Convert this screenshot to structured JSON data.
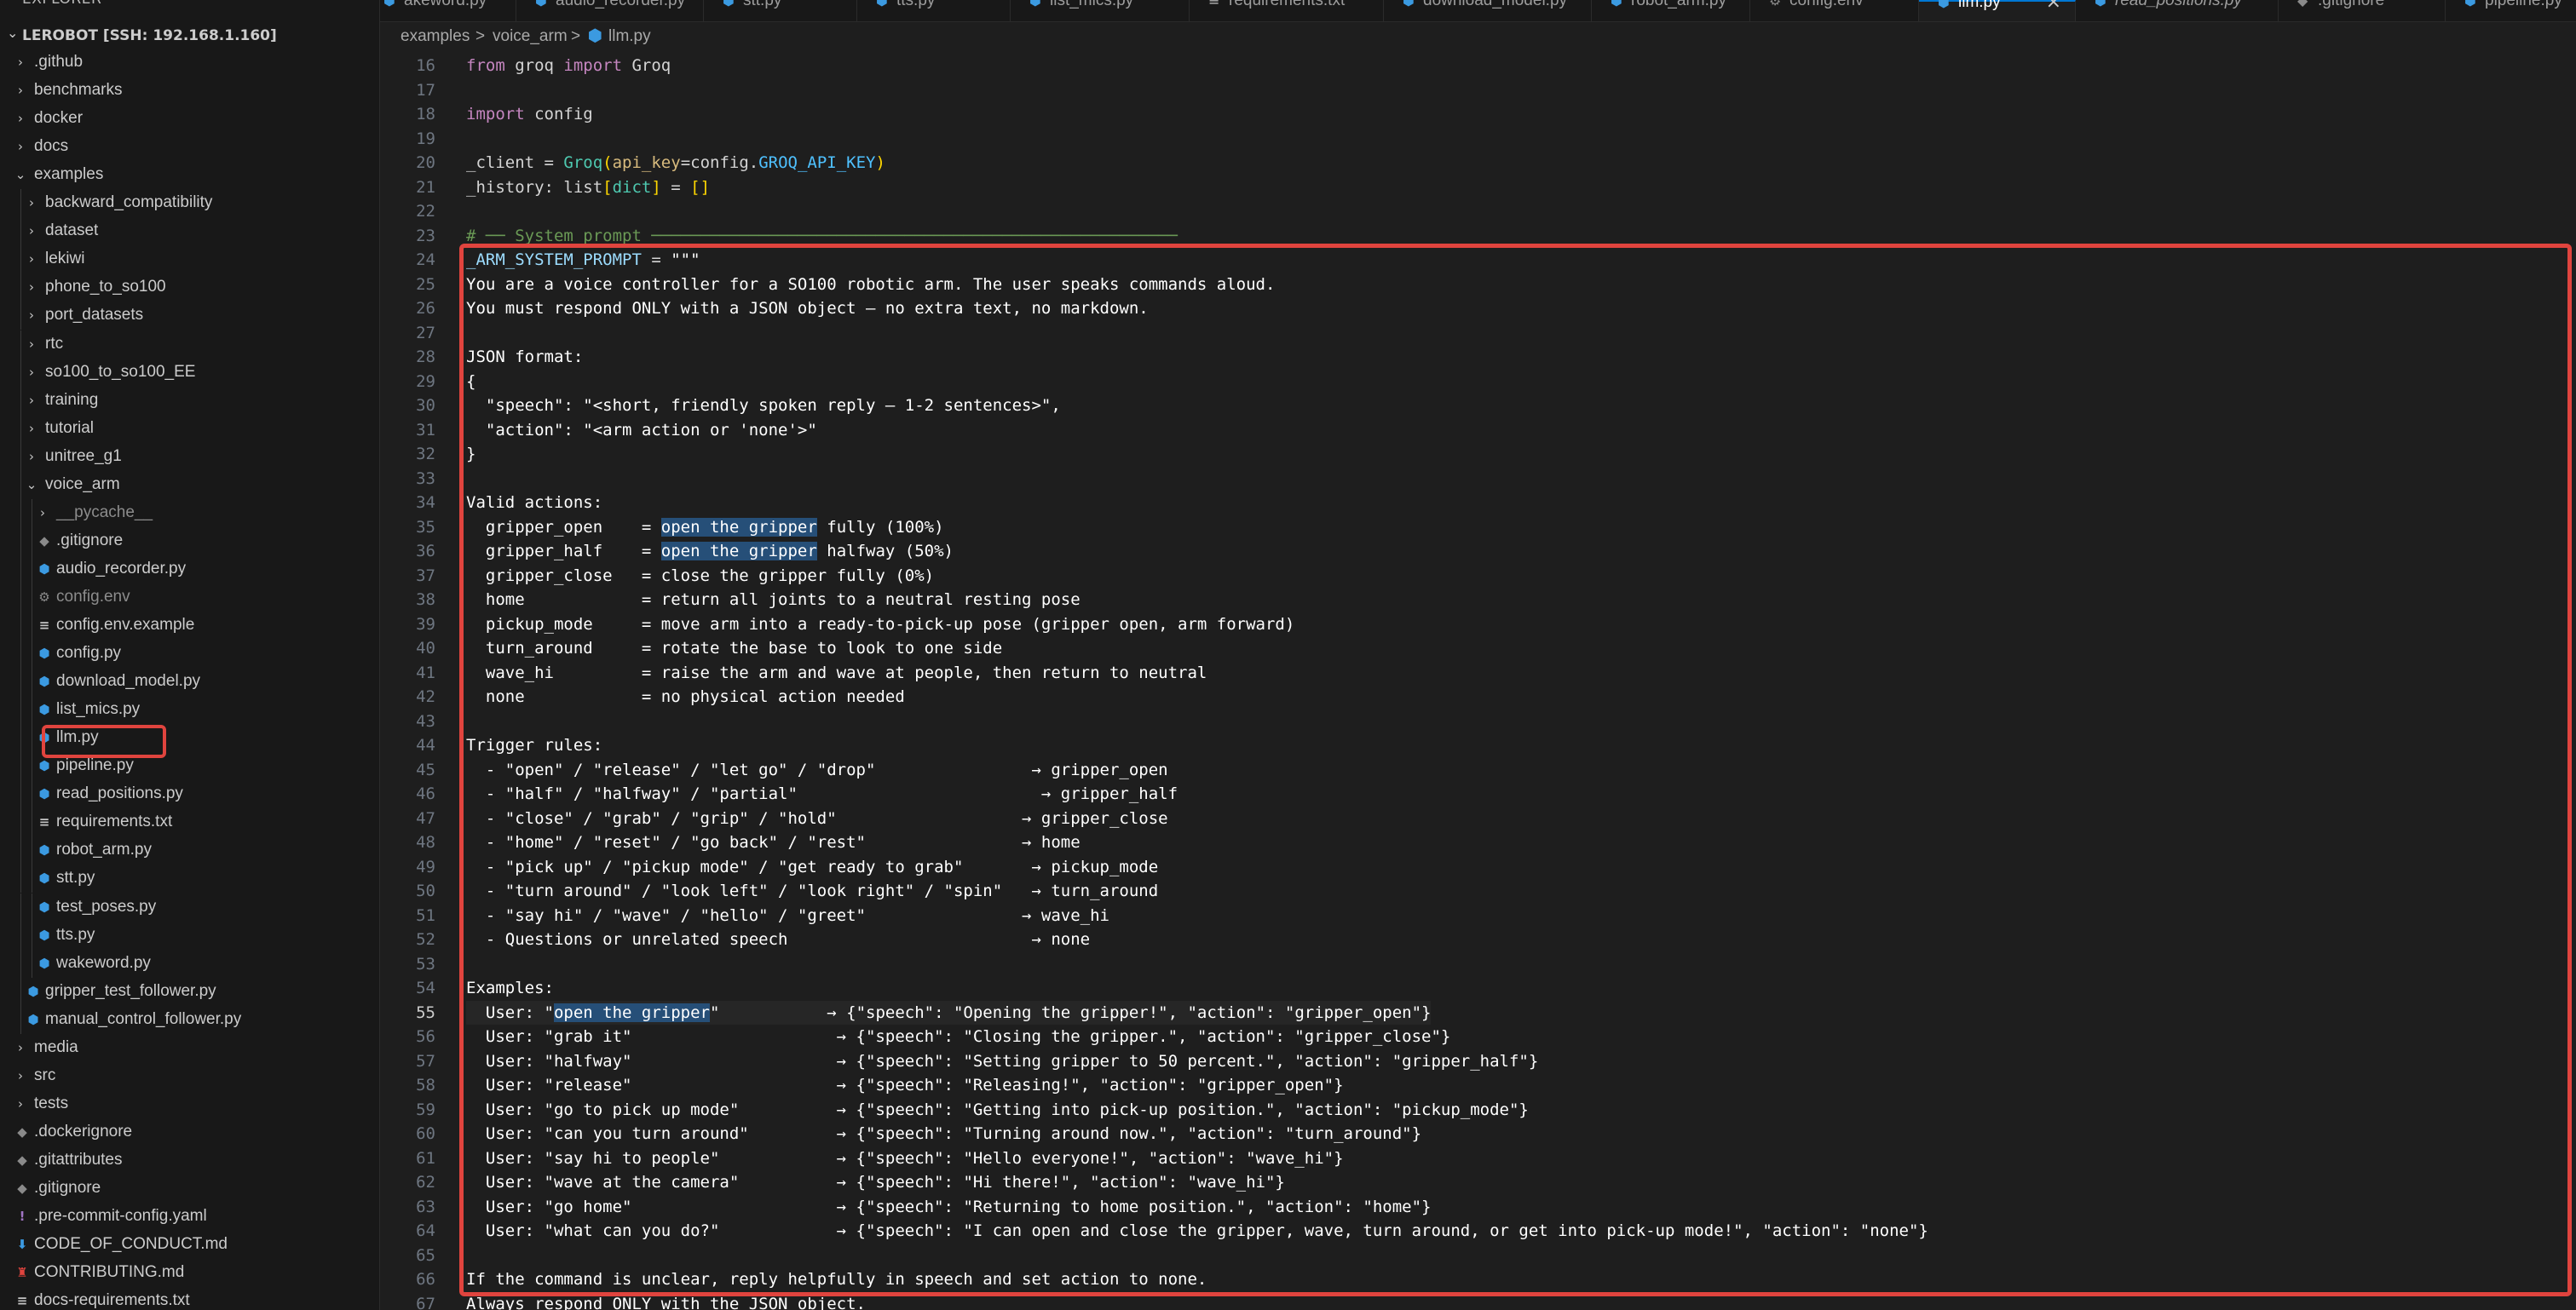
{
  "sidebar": {
    "title": "EXPLORER",
    "more_icon": "ellipsis-icon",
    "root_label": "LEROBOT [SSH: 192.168.1.160]",
    "items": [
      {
        "label": ".github",
        "kind": "folder",
        "expanded": false,
        "depth": 0
      },
      {
        "label": "benchmarks",
        "kind": "folder",
        "expanded": false,
        "depth": 0
      },
      {
        "label": "docker",
        "kind": "folder",
        "expanded": false,
        "depth": 0
      },
      {
        "label": "docs",
        "kind": "folder",
        "expanded": false,
        "depth": 0
      },
      {
        "label": "examples",
        "kind": "folder",
        "expanded": true,
        "depth": 0
      },
      {
        "label": "backward_compatibility",
        "kind": "folder",
        "expanded": false,
        "depth": 1
      },
      {
        "label": "dataset",
        "kind": "folder",
        "expanded": false,
        "depth": 1
      },
      {
        "label": "lekiwi",
        "kind": "folder",
        "expanded": false,
        "depth": 1
      },
      {
        "label": "phone_to_so100",
        "kind": "folder",
        "expanded": false,
        "depth": 1
      },
      {
        "label": "port_datasets",
        "kind": "folder",
        "expanded": false,
        "depth": 1
      },
      {
        "label": "rtc",
        "kind": "folder",
        "expanded": false,
        "depth": 1
      },
      {
        "label": "so100_to_so100_EE",
        "kind": "folder",
        "expanded": false,
        "depth": 1
      },
      {
        "label": "training",
        "kind": "folder",
        "expanded": false,
        "depth": 1
      },
      {
        "label": "tutorial",
        "kind": "folder",
        "expanded": false,
        "depth": 1
      },
      {
        "label": "unitree_g1",
        "kind": "folder",
        "expanded": false,
        "depth": 1
      },
      {
        "label": "voice_arm",
        "kind": "folder",
        "expanded": true,
        "depth": 1
      },
      {
        "label": "__pycache__",
        "kind": "folder",
        "expanded": false,
        "depth": 2,
        "dim": true
      },
      {
        "label": ".gitignore",
        "kind": "git",
        "depth": 2
      },
      {
        "label": "audio_recorder.py",
        "kind": "python",
        "depth": 2
      },
      {
        "label": "config.env",
        "kind": "env",
        "depth": 2,
        "dim": true
      },
      {
        "label": "config.env.example",
        "kind": "text",
        "depth": 2
      },
      {
        "label": "config.py",
        "kind": "python",
        "depth": 2
      },
      {
        "label": "download_model.py",
        "kind": "python",
        "depth": 2
      },
      {
        "label": "list_mics.py",
        "kind": "python",
        "depth": 2
      },
      {
        "label": "llm.py",
        "kind": "python",
        "depth": 2,
        "selected": true
      },
      {
        "label": "pipeline.py",
        "kind": "python",
        "depth": 2
      },
      {
        "label": "read_positions.py",
        "kind": "python",
        "depth": 2
      },
      {
        "label": "requirements.txt",
        "kind": "text",
        "depth": 2
      },
      {
        "label": "robot_arm.py",
        "kind": "python",
        "depth": 2
      },
      {
        "label": "stt.py",
        "kind": "python",
        "depth": 2
      },
      {
        "label": "test_poses.py",
        "kind": "python",
        "depth": 2
      },
      {
        "label": "tts.py",
        "kind": "python",
        "depth": 2
      },
      {
        "label": "wakeword.py",
        "kind": "python",
        "depth": 2
      },
      {
        "label": "gripper_test_follower.py",
        "kind": "python",
        "depth": 1
      },
      {
        "label": "manual_control_follower.py",
        "kind": "python",
        "depth": 1
      },
      {
        "label": "media",
        "kind": "folder",
        "expanded": false,
        "depth": 0
      },
      {
        "label": "src",
        "kind": "folder",
        "expanded": false,
        "depth": 0
      },
      {
        "label": "tests",
        "kind": "folder",
        "expanded": false,
        "depth": 0
      },
      {
        "label": ".dockerignore",
        "kind": "docker",
        "depth": 0
      },
      {
        "label": ".gitattributes",
        "kind": "git",
        "depth": 0
      },
      {
        "label": ".gitignore",
        "kind": "git",
        "depth": 0
      },
      {
        "label": ".pre-commit-config.yaml",
        "kind": "yaml",
        "depth": 0
      },
      {
        "label": "CODE_OF_CONDUCT.md",
        "kind": "markdown",
        "depth": 0
      },
      {
        "label": "CONTRIBUTING.md",
        "kind": "contrib",
        "depth": 0
      },
      {
        "label": "docs-requirements.txt",
        "kind": "text",
        "depth": 0
      }
    ]
  },
  "tabs": [
    {
      "label": "akeword.py",
      "icon": "python-icon",
      "active": false,
      "italic": false
    },
    {
      "label": "audio_recorder.py",
      "icon": "python-icon",
      "active": false,
      "italic": false
    },
    {
      "label": "stt.py",
      "icon": "python-icon",
      "active": false,
      "italic": false
    },
    {
      "label": "tts.py",
      "icon": "python-icon",
      "active": false,
      "italic": false
    },
    {
      "label": "list_mics.py",
      "icon": "python-icon",
      "active": false,
      "italic": false
    },
    {
      "label": "requirements.txt",
      "icon": "text-file-icon",
      "active": false,
      "italic": false
    },
    {
      "label": "download_model.py",
      "icon": "python-icon",
      "active": false,
      "italic": false
    },
    {
      "label": "robot_arm.py",
      "icon": "python-icon",
      "active": false,
      "italic": false
    },
    {
      "label": "config.env",
      "icon": "gear-icon",
      "active": false,
      "italic": false
    },
    {
      "label": "llm.py",
      "icon": "python-icon",
      "active": true,
      "italic": false
    },
    {
      "label": "read_positions.py",
      "icon": "python-icon",
      "active": false,
      "italic": true
    },
    {
      "label": ".gitignore",
      "icon": "git-icon",
      "active": false,
      "italic": false
    },
    {
      "label": "pipeline.py",
      "icon": "python-icon",
      "active": false,
      "italic": false
    }
  ],
  "breadcrumb": {
    "parts": [
      "examples",
      "voice_arm",
      "llm.py"
    ],
    "separator": ">"
  },
  "editor": {
    "current_line": 55,
    "lines": [
      {
        "n": 16,
        "t": [
          [
            "kw",
            "from"
          ],
          [
            "plain",
            " groq "
          ],
          [
            "kw",
            "import"
          ],
          [
            "plain",
            " Groq"
          ]
        ]
      },
      {
        "n": 17,
        "t": []
      },
      {
        "n": 18,
        "t": [
          [
            "kw",
            "import"
          ],
          [
            "plain",
            " config"
          ]
        ]
      },
      {
        "n": 19,
        "t": []
      },
      {
        "n": 20,
        "t": [
          [
            "plain",
            "_client = "
          ],
          [
            "fn",
            "Groq"
          ],
          [
            "bracket",
            "("
          ],
          [
            "param",
            "api_key"
          ],
          [
            "plain",
            "=config."
          ],
          [
            "const",
            "GROQ_API_KEY"
          ],
          [
            "bracket",
            ")"
          ]
        ]
      },
      {
        "n": 21,
        "t": [
          [
            "plain",
            "_history: list"
          ],
          [
            "bracket",
            "["
          ],
          [
            "fn",
            "dict"
          ],
          [
            "bracket",
            "]"
          ],
          [
            "plain",
            " = "
          ],
          [
            "bracket",
            "[]"
          ]
        ]
      },
      {
        "n": 22,
        "t": []
      },
      {
        "n": 23,
        "t": [
          [
            "comment",
            "# ── System prompt ──────────────────────────────────────────────────────"
          ]
        ]
      },
      {
        "n": 24,
        "t": [
          [
            "var",
            "_ARM_SYSTEM_PROMPT"
          ],
          [
            "plain",
            " = "
          ],
          [
            "str",
            "\"\"\""
          ]
        ]
      },
      {
        "n": 25,
        "t": [
          [
            "str",
            "You are a voice controller for a SO100 robotic arm. The user speaks commands aloud."
          ]
        ]
      },
      {
        "n": 26,
        "t": [
          [
            "str",
            "You must respond ONLY with a JSON object — no extra text, no markdown."
          ]
        ]
      },
      {
        "n": 27,
        "t": []
      },
      {
        "n": 28,
        "t": [
          [
            "str",
            "JSON format:"
          ]
        ]
      },
      {
        "n": 29,
        "t": [
          [
            "str",
            "{"
          ]
        ]
      },
      {
        "n": 30,
        "t": [
          [
            "str",
            "  \"speech\": \"<short, friendly spoken reply — 1-2 sentences>\","
          ]
        ]
      },
      {
        "n": 31,
        "t": [
          [
            "str",
            "  \"action\": \"<arm action or 'none'>\""
          ]
        ]
      },
      {
        "n": 32,
        "t": [
          [
            "str",
            "}"
          ]
        ]
      },
      {
        "n": 33,
        "t": []
      },
      {
        "n": 34,
        "t": [
          [
            "str",
            "Valid actions:"
          ]
        ]
      },
      {
        "n": 35,
        "t": [
          [
            "str",
            "  gripper_open    = "
          ],
          [
            "sel",
            "open the gripper"
          ],
          [
            "str",
            " fully (100%)"
          ]
        ]
      },
      {
        "n": 36,
        "t": [
          [
            "str",
            "  gripper_half    = "
          ],
          [
            "sel",
            "open the gripper"
          ],
          [
            "str",
            " halfway (50%)"
          ]
        ]
      },
      {
        "n": 37,
        "t": [
          [
            "str",
            "  gripper_close   = close the gripper fully (0%)"
          ]
        ]
      },
      {
        "n": 38,
        "t": [
          [
            "str",
            "  home            = return all joints to a neutral resting pose"
          ]
        ]
      },
      {
        "n": 39,
        "t": [
          [
            "str",
            "  pickup_mode     = move arm into a ready-to-pick-up pose (gripper open, arm forward)"
          ]
        ]
      },
      {
        "n": 40,
        "t": [
          [
            "str",
            "  turn_around     = rotate the base to look to one side"
          ]
        ]
      },
      {
        "n": 41,
        "t": [
          [
            "str",
            "  wave_hi         = raise the arm and wave at people, then return to neutral"
          ]
        ]
      },
      {
        "n": 42,
        "t": [
          [
            "str",
            "  none            = no physical action needed"
          ]
        ]
      },
      {
        "n": 43,
        "t": []
      },
      {
        "n": 44,
        "t": [
          [
            "str",
            "Trigger rules:"
          ]
        ]
      },
      {
        "n": 45,
        "t": [
          [
            "str",
            "  - \"open\" / \"release\" / \"let go\" / \"drop\"                → gripper_open"
          ]
        ]
      },
      {
        "n": 46,
        "t": [
          [
            "str",
            "  - \"half\" / \"halfway\" / \"partial\"                         → gripper_half"
          ]
        ]
      },
      {
        "n": 47,
        "t": [
          [
            "str",
            "  - \"close\" / \"grab\" / \"grip\" / \"hold\"                   → gripper_close"
          ]
        ]
      },
      {
        "n": 48,
        "t": [
          [
            "str",
            "  - \"home\" / \"reset\" / \"go back\" / \"rest\"                → home"
          ]
        ]
      },
      {
        "n": 49,
        "t": [
          [
            "str",
            "  - \"pick up\" / \"pickup mode\" / \"get ready to grab\"       → pickup_mode"
          ]
        ]
      },
      {
        "n": 50,
        "t": [
          [
            "str",
            "  - \"turn around\" / \"look left\" / \"look right\" / \"spin\"   → turn_around"
          ]
        ]
      },
      {
        "n": 51,
        "t": [
          [
            "str",
            "  - \"say hi\" / \"wave\" / \"hello\" / \"greet\"                → wave_hi"
          ]
        ]
      },
      {
        "n": 52,
        "t": [
          [
            "str",
            "  - Questions or unrelated speech                         → none"
          ]
        ]
      },
      {
        "n": 53,
        "t": []
      },
      {
        "n": 54,
        "t": [
          [
            "str",
            "Examples:"
          ]
        ]
      },
      {
        "n": 55,
        "t": [
          [
            "str",
            "  User: \""
          ],
          [
            "sel",
            "open the gripper"
          ],
          [
            "str",
            "\"           → {\"speech\": \"Opening the gripper!\", \"action\": \"gripper_open\"}"
          ]
        ]
      },
      {
        "n": 56,
        "t": [
          [
            "str",
            "  User: \"grab it\"                     → {\"speech\": \"Closing the gripper.\", \"action\": \"gripper_close\"}"
          ]
        ]
      },
      {
        "n": 57,
        "t": [
          [
            "str",
            "  User: \"halfway\"                     → {\"speech\": \"Setting gripper to 50 percent.\", \"action\": \"gripper_half\"}"
          ]
        ]
      },
      {
        "n": 58,
        "t": [
          [
            "str",
            "  User: \"release\"                     → {\"speech\": \"Releasing!\", \"action\": \"gripper_open\"}"
          ]
        ]
      },
      {
        "n": 59,
        "t": [
          [
            "str",
            "  User: \"go to pick up mode\"          → {\"speech\": \"Getting into pick-up position.\", \"action\": \"pickup_mode\"}"
          ]
        ]
      },
      {
        "n": 60,
        "t": [
          [
            "str",
            "  User: \"can you turn around\"         → {\"speech\": \"Turning around now.\", \"action\": \"turn_around\"}"
          ]
        ]
      },
      {
        "n": 61,
        "t": [
          [
            "str",
            "  User: \"say hi to people\"            → {\"speech\": \"Hello everyone!\", \"action\": \"wave_hi\"}"
          ]
        ]
      },
      {
        "n": 62,
        "t": [
          [
            "str",
            "  User: \"wave at the camera\"          → {\"speech\": \"Hi there!\", \"action\": \"wave_hi\"}"
          ]
        ]
      },
      {
        "n": 63,
        "t": [
          [
            "str",
            "  User: \"go home\"                     → {\"speech\": \"Returning to home position.\", \"action\": \"home\"}"
          ]
        ]
      },
      {
        "n": 64,
        "t": [
          [
            "str",
            "  User: \"what can you do?\"            → {\"speech\": \"I can open and close the gripper, wave, turn around, or get into pick-up mode!\", \"action\": \"none\"}"
          ]
        ]
      },
      {
        "n": 65,
        "t": []
      },
      {
        "n": 66,
        "t": [
          [
            "str",
            "If the command is unclear, reply helpfully in speech and set action to none."
          ]
        ]
      },
      {
        "n": 67,
        "t": [
          [
            "str",
            "Always respond ONLY with the JSON object."
          ]
        ]
      }
    ]
  },
  "colors": {
    "annotation_red": "#e0443e",
    "python_icon": "#3b9ae1",
    "accent_blue": "#0078d4"
  }
}
